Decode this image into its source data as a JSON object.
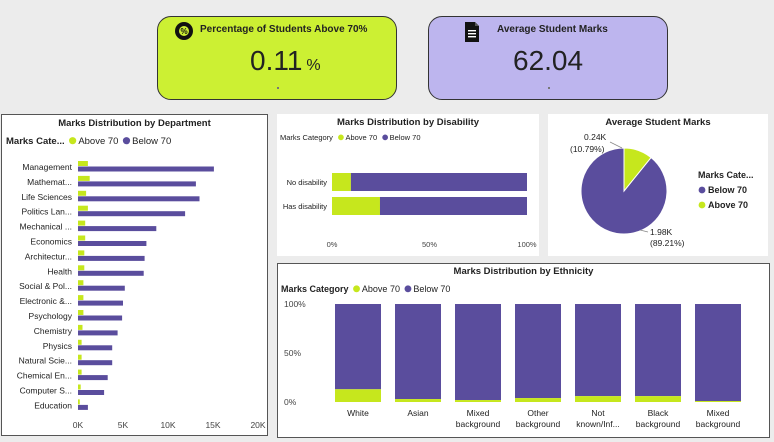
{
  "kpis": {
    "above70": {
      "title": "Percentage of Students Above 70%",
      "value": "0.11",
      "unit": "%"
    },
    "average": {
      "title": "Average Student Marks",
      "value": "62.04"
    }
  },
  "colors": {
    "above": "#c6e71d",
    "below": "#5a4d9d",
    "kpi1_bg": "#ccf033",
    "kpi2_bg": "#bdb5ee"
  },
  "chart_data": [
    {
      "id": "dept",
      "type": "bar",
      "orientation": "horizontal",
      "title": "Marks Distribution by Department",
      "legend_title": "Marks Cate...",
      "categories": [
        "Management",
        "Mathemat...",
        "Life Sciences",
        "Politics Lan...",
        "Mechanical ...",
        "Economics",
        "Architectur...",
        "Health",
        "Social & Pol...",
        "Electronic &...",
        "Psychology",
        "Chemistry",
        "Physics",
        "Natural Scie...",
        "Chemical En...",
        "Computer S...",
        "Education"
      ],
      "series": [
        {
          "name": "Above 70",
          "values": [
            1100,
            1300,
            900,
            1100,
            800,
            800,
            700,
            700,
            600,
            600,
            600,
            500,
            400,
            400,
            400,
            300,
            200
          ]
        },
        {
          "name": "Below 70",
          "values": [
            15100,
            13100,
            13500,
            11900,
            8700,
            7600,
            7400,
            7300,
            5200,
            5000,
            4900,
            4400,
            3800,
            3800,
            3300,
            2900,
            1100
          ]
        }
      ],
      "xlim": [
        0,
        20000
      ],
      "xticks": [
        "0K",
        "5K",
        "10K",
        "15K",
        "20K"
      ]
    },
    {
      "id": "disability",
      "type": "bar",
      "orientation": "horizontal",
      "stacked": "100%",
      "title": "Marks Distribution by Disability",
      "legend_title": "Marks Category",
      "categories": [
        "No disability",
        "Has disability"
      ],
      "series": [
        {
          "name": "Above 70",
          "values": [
            9.7,
            24.6
          ]
        },
        {
          "name": "Below 70",
          "values": [
            90.3,
            75.4
          ]
        }
      ],
      "xticks": [
        "0%",
        "50%",
        "100%"
      ]
    },
    {
      "id": "pie",
      "type": "pie",
      "title": "Average Student Marks",
      "legend_title": "Marks Cate...",
      "slices": [
        {
          "name": "Below 70",
          "value": 1980,
          "label": "1.98K",
          "pct": "(89.21%)"
        },
        {
          "name": "Above 70",
          "value": 240,
          "label": "0.24K",
          "pct": "(10.79%)"
        }
      ]
    },
    {
      "id": "ethnicity",
      "type": "bar",
      "stacked": "100%",
      "title": "Marks Distribution by Ethnicity",
      "legend_title": "Marks Category",
      "categories": [
        "White",
        "Asian",
        "Mixed background",
        "Other background",
        "Not known/Inf...",
        "Black background",
        "Mixed background"
      ],
      "category_lines": [
        [
          "White"
        ],
        [
          "Asian"
        ],
        [
          "Mixed",
          "background"
        ],
        [
          "Other",
          "background"
        ],
        [
          "Not",
          "known/Inf..."
        ],
        [
          "Black",
          "background"
        ],
        [
          "Mixed",
          "background"
        ]
      ],
      "series": [
        {
          "name": "Above 70",
          "values": [
            13,
            3,
            2,
            4,
            6,
            6,
            1
          ]
        },
        {
          "name": "Below 70",
          "values": [
            87,
            97,
            98,
            96,
            94,
            94,
            99
          ]
        }
      ],
      "yticks": [
        "100%",
        "50%",
        "0%"
      ]
    }
  ]
}
